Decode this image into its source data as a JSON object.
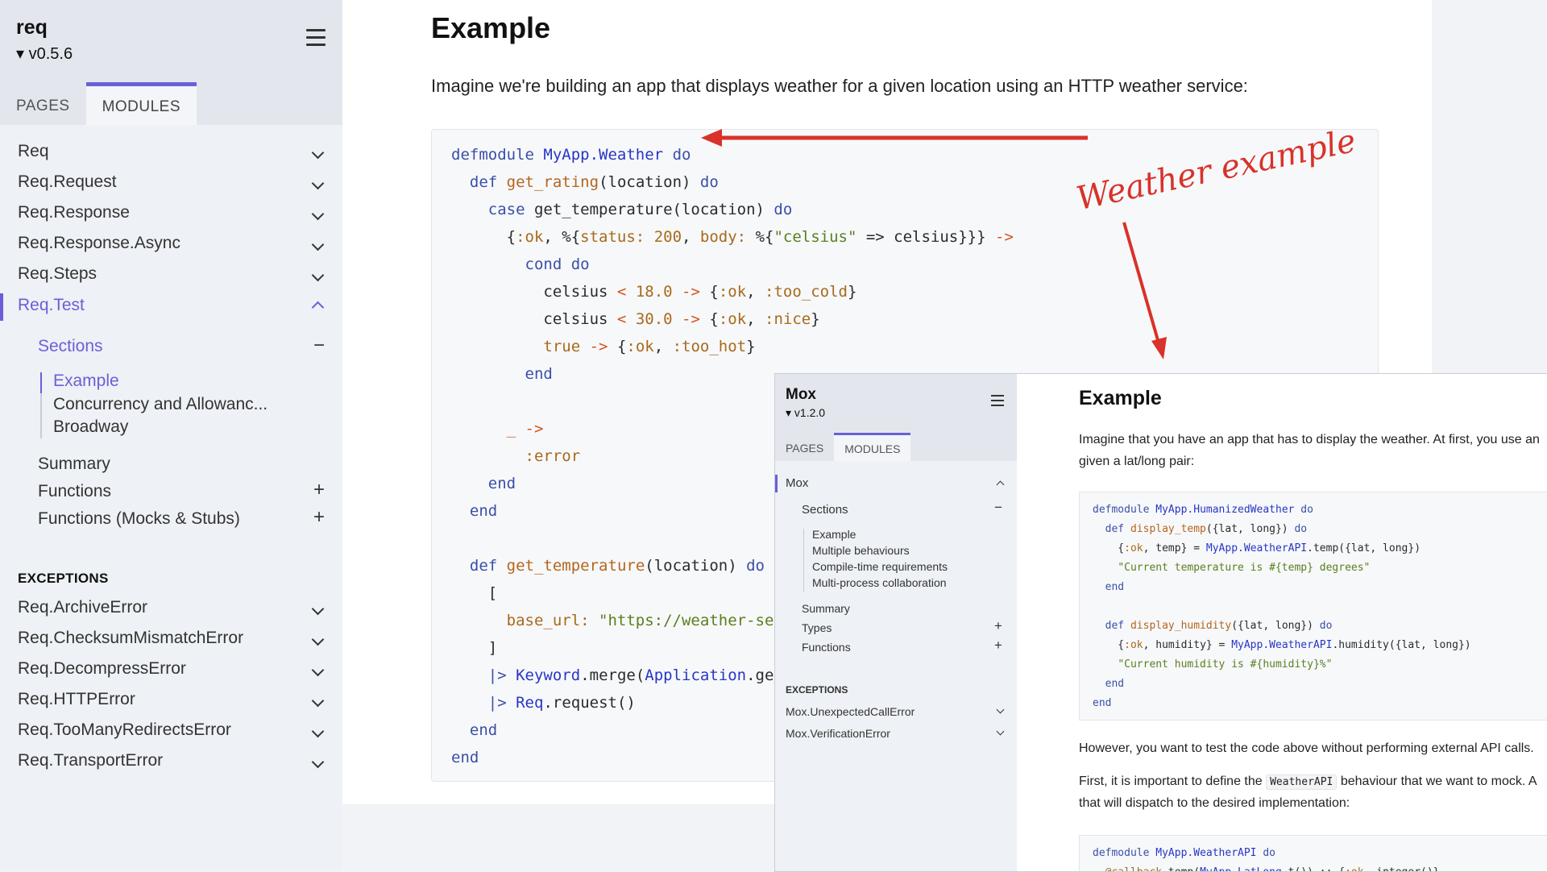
{
  "sidebar": {
    "project": "req",
    "version": "▾ v0.5.6",
    "tabs": [
      "PAGES",
      "MODULES"
    ],
    "modules": [
      "Req",
      "Req.Request",
      "Req.Response",
      "Req.Response.Async",
      "Req.Steps",
      "Req.Test"
    ],
    "sections_label": "Sections",
    "sections": [
      "Example",
      "Concurrency and Allowanc...",
      "Broadway"
    ],
    "summary": "Summary",
    "functions": "Functions",
    "functions_mocks": "Functions (Mocks & Stubs)",
    "exceptions_heading": "EXCEPTIONS",
    "exceptions": [
      "Req.ArchiveError",
      "Req.ChecksumMismatchError",
      "Req.DecompressError",
      "Req.HTTPError",
      "Req.TooManyRedirectsError",
      "Req.TransportError"
    ]
  },
  "content": {
    "title": "Example",
    "intro": "Imagine we're building an app that displays weather for a given location using an HTTP weather service:"
  },
  "annotation": {
    "text": "Weather example",
    "color": "#d8322a"
  },
  "mox": {
    "project": "Mox",
    "version": "▾ v1.2.0",
    "tabs": [
      "PAGES",
      "MODULES"
    ],
    "module": "Mox",
    "sections_label": "Sections",
    "sections": [
      "Example",
      "Multiple behaviours",
      "Compile-time requirements",
      "Multi-process collaboration"
    ],
    "summary": "Summary",
    "types": "Types",
    "functions": "Functions",
    "exceptions_heading": "EXCEPTIONS",
    "exceptions": [
      "Mox.UnexpectedCallError",
      "Mox.VerificationError"
    ],
    "title": "Example",
    "para1_line1": "Imagine that you have an app that has to display the weather. At first, you use an",
    "para1_line2": "given a lat/long pair:",
    "para2": "However, you want to test the code above without performing external API calls.",
    "para3_pre": "First, it is important to define the",
    "para3_code": "WeatherAPI",
    "para3_post": "behaviour that we want to mock. A",
    "para3_line2": "that will dispatch to the desired implementation:"
  },
  "colors": {
    "accent": "#6a5fd8",
    "arrow": "#d8322a"
  }
}
